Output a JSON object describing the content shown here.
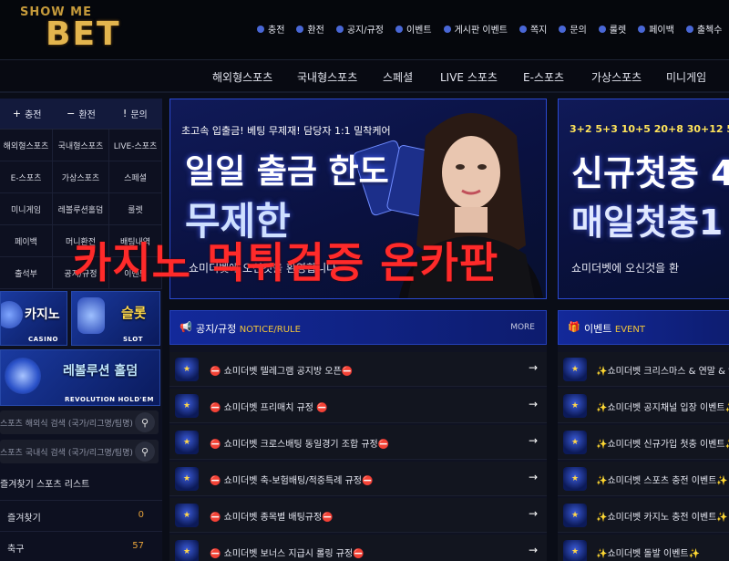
{
  "logo": {
    "line1": "SHOW ME",
    "line2": "BET"
  },
  "topnav": [
    "충전",
    "환전",
    "공지/규정",
    "이벤트",
    "게시판 이벤트",
    "쪽지",
    "문의",
    "룰렛",
    "페이백",
    "출첵수"
  ],
  "subnav": [
    "해외형스포츠",
    "국내형스포츠",
    "스페셜",
    "LIVE 스포츠",
    "E-스포츠",
    "가상스포츠",
    "미니게임"
  ],
  "sidebar": {
    "quick": [
      {
        "icon": "+",
        "label": "충전"
      },
      {
        "icon": "−",
        "label": "환전"
      },
      {
        "icon": "!",
        "label": "문의"
      }
    ],
    "categories": [
      "해외형스포츠",
      "국내형스포츠",
      "LIVE-스포츠",
      "E-스포츠",
      "가상스포츠",
      "스페셜",
      "미니게임",
      "레볼루션홀덤",
      "룰렛",
      "페이백",
      "머니환전",
      "배팅내역",
      "출석부",
      "공지/규정",
      "이벤트"
    ],
    "banners": [
      {
        "title": "카지노",
        "sub": "CASINO"
      },
      {
        "title": "슬롯",
        "sub": "SLOT"
      },
      {
        "title": "레볼루션 홀덤",
        "sub": "REVOLUTION HOLD'EM"
      }
    ],
    "search": [
      {
        "placeholder": "스포츠 해외식 검색 (국가/리그명/팀명)"
      },
      {
        "placeholder": "스포츠 국내식 검색 (국가/리그명/팀명)"
      }
    ],
    "sports_title": "즐겨찾기 스포츠 리스트",
    "sports": [
      {
        "name": "즐겨찾기",
        "count": "0"
      },
      {
        "name": "축구",
        "count": "57"
      }
    ]
  },
  "hero1": {
    "tag": "초고속 입출금! 베팅 무제재! 담당자 1:1 밀착케어",
    "line1": "일일 출금 한도",
    "line2": "무제한",
    "foot": "쇼미더벳에 오신것을 환영합니다"
  },
  "hero2": {
    "tag": "3+2 5+3 10+5 20+8 30+12 50+",
    "line1": "신규첫충 4",
    "line2": "매일첫충1",
    "foot": "쇼미더벳에 오신것을 환"
  },
  "overlay": "카지노 먹튀검증 온카판",
  "notice": {
    "icon": "megaphone-icon",
    "title": "공지/규정",
    "subtitle": "NOTICE/RULE",
    "more": "MORE",
    "rows": [
      "쇼미더벳 텔레그램 공지방 오픈",
      "쇼미더벳 프리매치 규정",
      "쇼미더벳 크로스배팅 동일경기 조합 규정",
      "쇼미더벳 축-보험배팅/적중특례 규정",
      "쇼미더벳 종목별 배팅규정",
      "쇼미더벳 보너스 지급시 롤링 규정"
    ]
  },
  "event": {
    "icon": "gift-icon",
    "title": "이벤트",
    "subtitle": "EVENT",
    "rows": [
      "쇼미더벳 크리스마스 & 연말 & 연초",
      "쇼미더벳 공지채널 입장 이벤트",
      "쇼미더벳 신규가입 첫충 이벤트",
      "쇼미더벳 스포츠 충전 이벤트",
      "쇼미더벳 카지노 충전 이벤트",
      "쇼미더벳 돌발 이벤트"
    ]
  }
}
